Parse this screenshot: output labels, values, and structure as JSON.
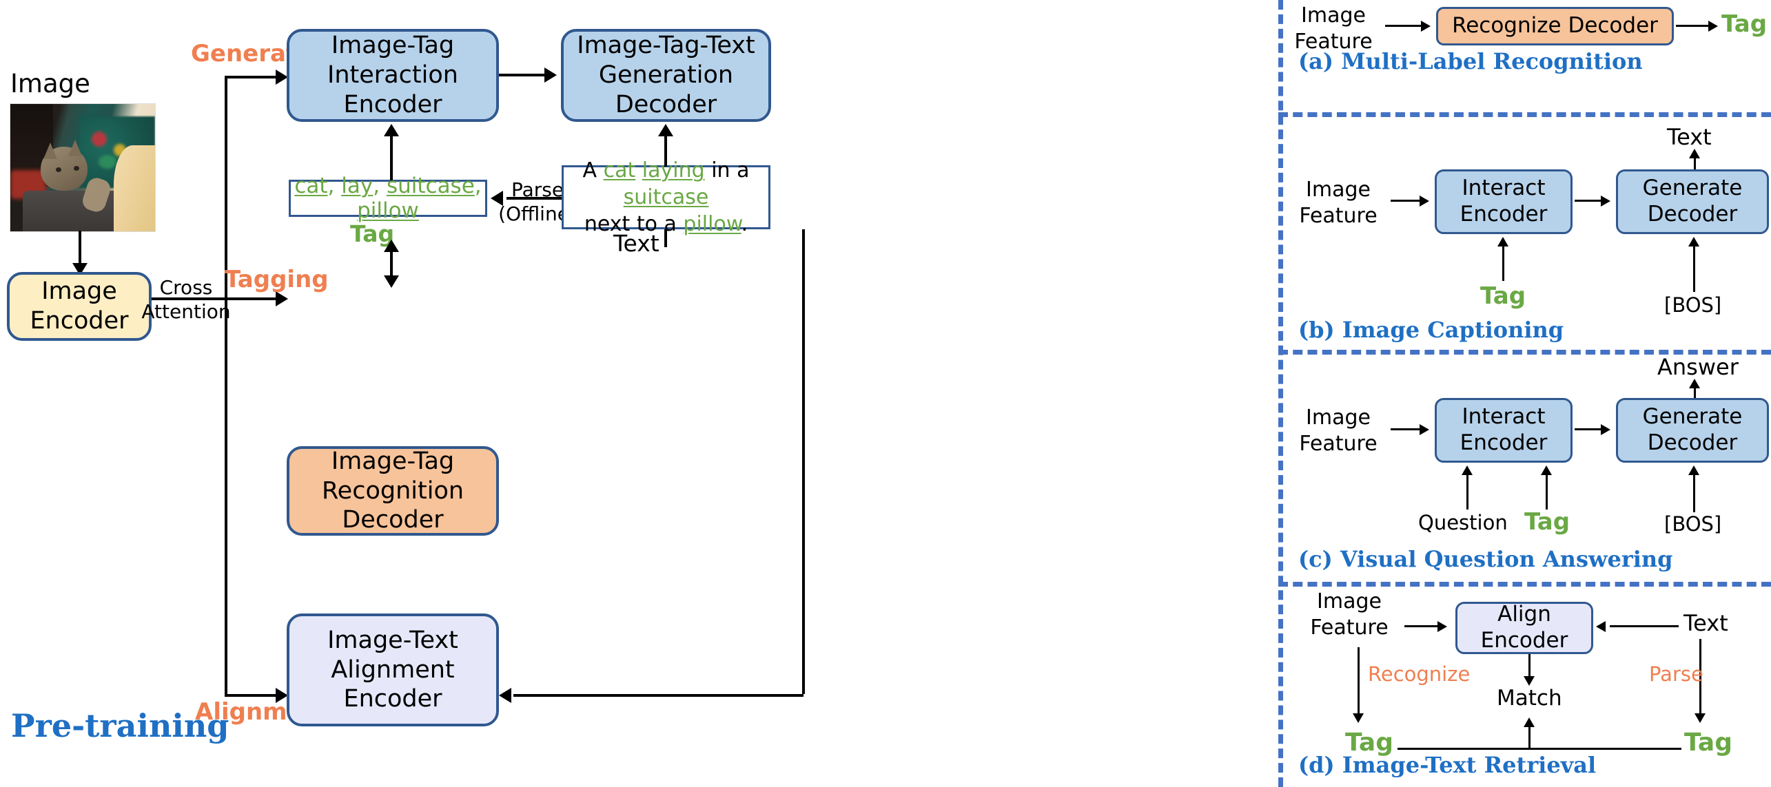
{
  "left_panel": {
    "section_title": "Pre-training",
    "image_label": "Image",
    "image_encoder": "Image\nEncoder",
    "cross_attention": "Cross\nAttention",
    "route_generation": "Generation",
    "route_tagging": "Tagging",
    "route_alignment": "Alignment",
    "interaction_encoder": "Image-Tag\nInteraction Encoder",
    "generation_decoder": "Image-Tag-Text\nGeneration Decoder",
    "recognition_decoder": "Image-Tag\nRecognition Decoder",
    "alignment_encoder": "Image-Text\nAlignment Encoder",
    "tag_box": {
      "words": [
        "cat",
        "lay",
        "suitcase",
        "pillow"
      ],
      "separator": ", ",
      "caption": "Tag"
    },
    "text_box": {
      "caption": "Text",
      "line1": [
        {
          "t": "A ",
          "tag": false
        },
        {
          "t": "cat",
          "tag": true
        },
        {
          "t": " ",
          "tag": false
        },
        {
          "t": "laying",
          "tag": true
        },
        {
          "t": " in a ",
          "tag": false
        },
        {
          "t": "suitcase",
          "tag": true
        }
      ],
      "line2": [
        {
          "t": "next to a ",
          "tag": false
        },
        {
          "t": "pillow",
          "tag": true
        },
        {
          "t": ".",
          "tag": false
        }
      ]
    },
    "parse_label": "Parse\n(Offline)"
  },
  "right_panel": {
    "panels": [
      {
        "id": "a",
        "caption": "(a) Multi-Label Recognition",
        "input_label": "Image\nFeature",
        "box": "Recognize Decoder",
        "output_label": "Tag"
      },
      {
        "id": "b",
        "caption": "(b) Image Captioning",
        "input_label": "Image\nFeature",
        "box1": "Interact\nEncoder",
        "box2": "Generate\nDecoder",
        "bottom1": "Tag",
        "bottom2": "[BOS]",
        "output_label": "Text"
      },
      {
        "id": "c",
        "caption": "(c) Visual Question Answering",
        "input_label": "Image\nFeature",
        "box1": "Interact\nEncoder",
        "box2": "Generate\nDecoder",
        "bottom1": "Question",
        "bottom2": "Tag",
        "bottom3": "[BOS]",
        "output_label": "Answer"
      },
      {
        "id": "d",
        "caption": "(d) Image-Text Retrieval",
        "input_label": "Image\nFeature",
        "box": "Align\nEncoder",
        "right_input": "Text",
        "left_edge": "Recognize",
        "right_edge": "Parse",
        "match_label": "Match",
        "tag_left": "Tag",
        "tag_right": "Tag"
      }
    ]
  },
  "colors": {
    "blue_box_fill": "#b6d2ea",
    "orange_box_fill": "#f7c39a",
    "yellow_box_fill": "#fdeec4",
    "lavender_box_fill": "#e6e8fa",
    "box_border": "#30588f",
    "accent_orange": "#ef7f50",
    "accent_green": "#6aa844",
    "accent_blue": "#1f6fc4",
    "divider_blue": "#4472c4"
  }
}
